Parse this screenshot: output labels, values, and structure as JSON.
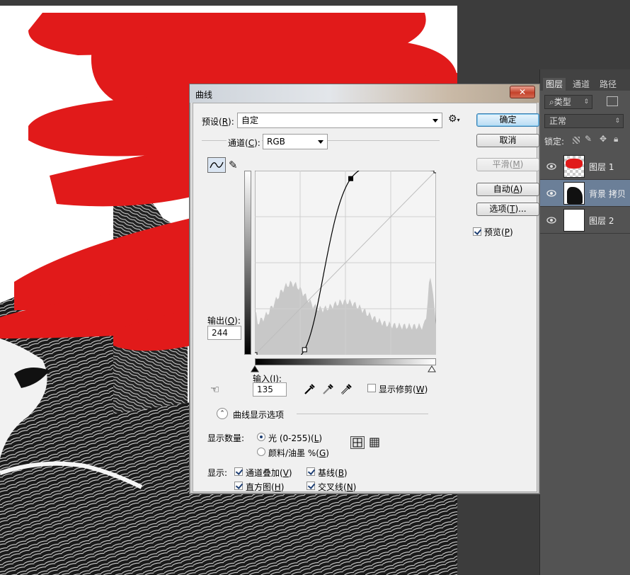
{
  "dialog": {
    "title": "曲线",
    "close_label": "✕",
    "preset_label": "预设(",
    "preset_key": "R",
    "preset_close": "):",
    "preset_value": "自定",
    "channel_label": "通道(",
    "channel_key": "C",
    "channel_close": "):",
    "channel_value": "RGB",
    "output_label": "输出(",
    "output_key": "O",
    "output_close": "):",
    "output_value": "244",
    "input_label": "输入(",
    "input_key": "I",
    "input_close": "):",
    "input_value": "135",
    "show_clipping_label": "显示修剪(",
    "show_clipping_key": "W",
    "show_clipping_close": ")",
    "show_clipping_checked": false,
    "options_title": "曲线显示选项",
    "show_amount_label": "显示数量:",
    "light_label": "光 (0-255)(",
    "light_key": "L",
    "light_close": ")",
    "pigment_label": "颜料/油墨 %(",
    "pigment_key": "G",
    "pigment_close": ")",
    "show_label": "显示:",
    "channel_overlays_label": "通道叠加(",
    "channel_overlays_key": "V",
    "channel_overlays_close": ")",
    "baseline_label": "基线(",
    "baseline_key": "B",
    "baseline_close": ")",
    "histogram_label": "直方图(",
    "histogram_key": "H",
    "histogram_close": ")",
    "intersection_label": "交叉线(",
    "intersection_key": "N",
    "intersection_close": ")"
  },
  "buttons": {
    "ok": "确定",
    "cancel": "取消",
    "smooth": "平滑(",
    "smooth_key": "M",
    "smooth_close": ")",
    "auto": "自动(",
    "auto_key": "A",
    "auto_close": ")",
    "options": "选项(",
    "options_key": "T",
    "options_close": ")...",
    "preview": "预览(",
    "preview_key": "P",
    "preview_close": ")"
  },
  "curve": {
    "points": [
      [
        0,
        0
      ],
      [
        70,
        7
      ],
      [
        135,
        244
      ],
      [
        255,
        255
      ]
    ],
    "selected_point": 2,
    "grid_divisions": 4
  },
  "layers_panel": {
    "tabs": [
      "图层",
      "通道",
      "路径"
    ],
    "filter_label": "类型",
    "blend_mode": "正常",
    "lock_label": "锁定:",
    "layers": [
      {
        "name": "图层 1",
        "selected": false
      },
      {
        "name": "背景 拷贝",
        "selected": true
      },
      {
        "name": "图层 2",
        "selected": false
      }
    ]
  },
  "colors": {
    "accent_red": "#e11a1a",
    "selected_layer": "#6b7f98",
    "ok_button": "#b8dcf4"
  }
}
